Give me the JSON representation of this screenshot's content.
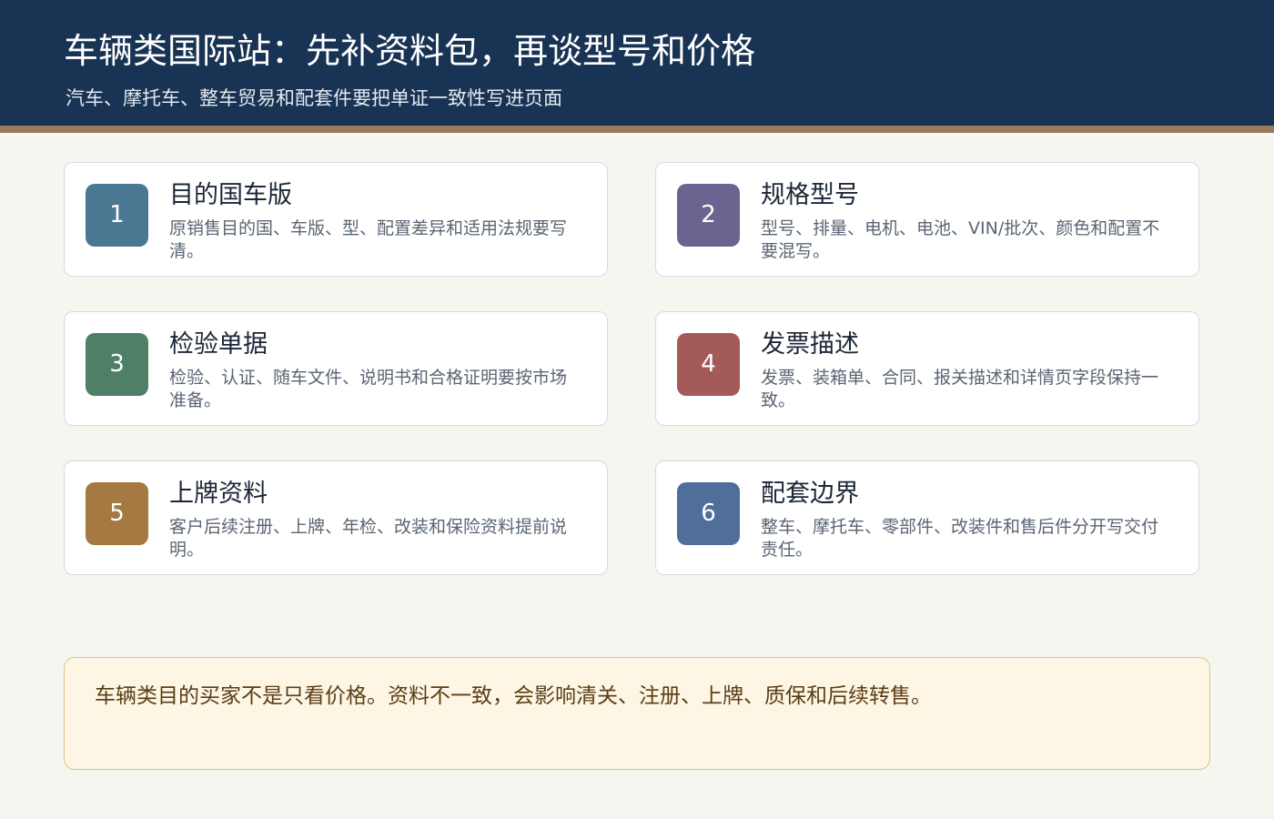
{
  "header": {
    "title": "车辆类国际站：先补资料包，再谈型号和价格",
    "subtitle": "汽车、摩托车、整车贸易和配套件要把单证一致性写进页面"
  },
  "cards": [
    {
      "number": "1",
      "title": "目的国车版",
      "description": "原销售目的国、车版、型、配置差异和适用法规要写清。",
      "color": "#4a7892"
    },
    {
      "number": "2",
      "title": "规格型号",
      "description": "型号、排量、电机、电池、VIN/批次、颜色和配置不要混写。",
      "color": "#6c6390"
    },
    {
      "number": "3",
      "title": "检验单据",
      "description": "检验、认证、随车文件、说明书和合格证明要按市场准备。",
      "color": "#4f7f66"
    },
    {
      "number": "4",
      "title": "发票描述",
      "description": "发票、装箱单、合同、报关描述和详情页字段保持一致。",
      "color": "#a35a58"
    },
    {
      "number": "5",
      "title": "上牌资料",
      "description": "客户后续注册、上牌、年检、改装和保险资料提前说明。",
      "color": "#a47a42"
    },
    {
      "number": "6",
      "title": "配套边界",
      "description": "整车、摩托车、零部件、改装件和售后件分开写交付责任。",
      "color": "#4f6e9a"
    }
  ],
  "note": {
    "text": "车辆类目的买家不是只看价格。资料不一致，会影响清关、注册、上牌、质保和后续转售。"
  }
}
